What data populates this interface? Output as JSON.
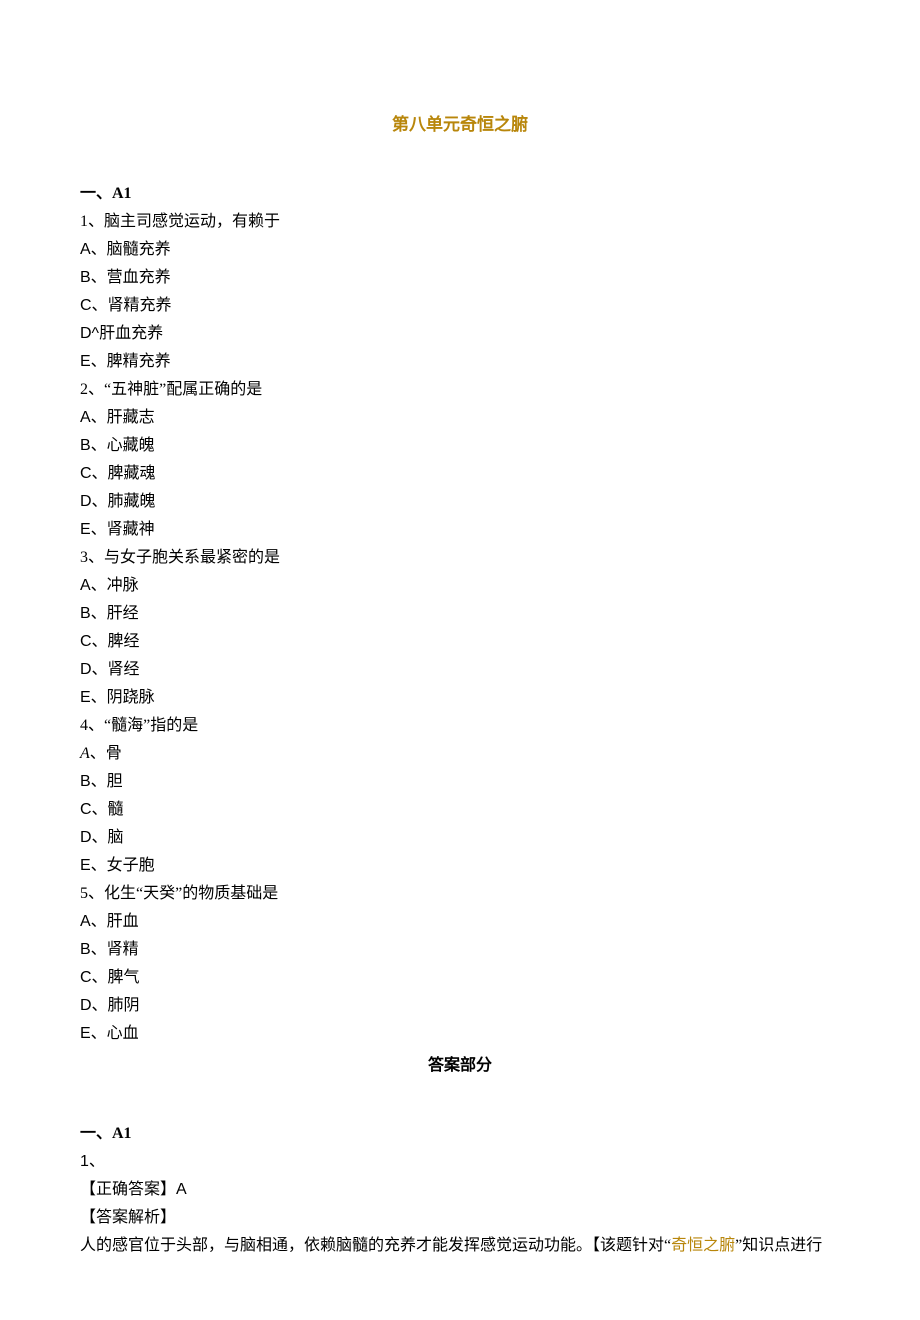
{
  "title": "第八单元奇恒之腑",
  "sectionA": "一、A1",
  "q1": {
    "stem": "1、脑主司感觉运动，有赖于",
    "A": "A、脑髓充养",
    "B": "B、营血充养",
    "C": "C、肾精充养",
    "D": "D^肝血充养",
    "E": "E、脾精充养"
  },
  "q2": {
    "stem": "2、“五神脏”配属正确的是",
    "A": "A、肝藏志",
    "B": "B、心藏魄",
    "C": "C、脾藏魂",
    "D": "D、肺藏魄",
    "E": "E、肾藏神"
  },
  "q3": {
    "stem": "3、与女子胞关系最紧密的是",
    "A": "A、冲脉",
    "B": "B、肝经",
    "C": "C、脾经",
    "D": "D、肾经",
    "E": "E、阴跷脉"
  },
  "q4": {
    "stem": "4、“髓海”指的是",
    "A_prefix": "A",
    "A_rest": "、骨",
    "B": "B、胆",
    "C": "C、髓",
    "D": "D、脑",
    "E": "E、女子胞"
  },
  "q5": {
    "stem": "5、化生“天癸”的物质基础是",
    "A": "A、肝血",
    "B": "B、肾精",
    "C": "C、脾气",
    "D": "D、肺阴",
    "E": "E、心血"
  },
  "answers_heading": "答案部分",
  "ans_sectionA": "一、A1",
  "ans1": {
    "num": "1、",
    "correct": "【正确答案】A",
    "analysis_label": "【答案解析】",
    "analysis_pre": "人的感官位于头部，与脑相通，依赖脑髓的充养才能发挥感觉运动功能。【该题针对“",
    "analysis_hl": "奇恒之腑",
    "analysis_post": "”知识点进行"
  }
}
